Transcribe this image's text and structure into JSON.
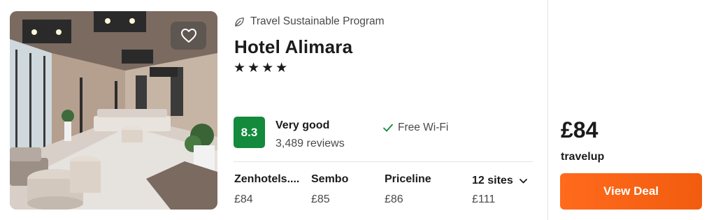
{
  "hotel": {
    "program_label": "Travel Sustainable Program",
    "name": "Hotel Alimara",
    "stars_display": "★★★★",
    "star_count": 4,
    "score": "8.3",
    "rating_label": "Very good",
    "reviews": "3,489 reviews",
    "amenity": "Free Wi-Fi"
  },
  "sites": [
    {
      "name": "Zenhotels....",
      "price": "£84"
    },
    {
      "name": "Sembo",
      "price": "£85"
    },
    {
      "name": "Priceline",
      "price": "£86"
    }
  ],
  "more_sites": {
    "label": "12 sites",
    "price": "£111"
  },
  "deal": {
    "price": "£84",
    "provider": "travelup",
    "button_label": "View Deal"
  },
  "colors": {
    "score_badge": "#138a3c",
    "deal_button": "#ff6a1c",
    "text_primary": "#1b1b1b",
    "text_secondary": "#4a4a4a"
  },
  "icons": {
    "favorite": "heart-outline-icon",
    "eco": "leaf-icon",
    "amenity": "checkmark-icon",
    "more_sites": "chevron-down-icon"
  }
}
